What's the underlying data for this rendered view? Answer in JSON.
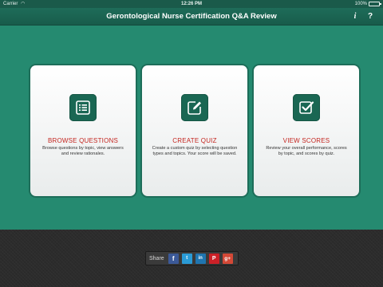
{
  "status_bar": {
    "carrier": "Carrier",
    "wifi_icon": "wifi-icon",
    "time": "12:26 PM",
    "battery": "100%",
    "battery_level": 1.0
  },
  "nav": {
    "title": "Gerontological Nurse Certification Q&A Review",
    "info_label": "i",
    "help_label": "?"
  },
  "cards": [
    {
      "title": "BROWSE QUESTIONS",
      "description": "Browse questions by topic, view answers and review rationales.",
      "icon": "list-icon"
    },
    {
      "title": "CREATE QUIZ",
      "description": "Create a custom quiz by selecting question types and topics. Your score will be saved.",
      "icon": "edit-icon"
    },
    {
      "title": "VIEW SCORES",
      "description": "Review your overall performance, scores by topic, and scores by quiz.",
      "icon": "checkbox-icon"
    }
  ],
  "share": {
    "label": "Share",
    "buttons": [
      {
        "icon": "facebook-icon",
        "glyph": "f"
      },
      {
        "icon": "twitter-icon",
        "glyph": "t"
      },
      {
        "icon": "linkedin-icon",
        "glyph": "in"
      },
      {
        "icon": "pinterest-icon",
        "glyph": "P"
      },
      {
        "icon": "google-plus-icon",
        "glyph": "g+"
      }
    ]
  },
  "colors": {
    "brand_green": "#258a70",
    "nav_green": "#1e6c59",
    "title_red": "#c4251f",
    "footer_dark": "#2c2c2c"
  }
}
